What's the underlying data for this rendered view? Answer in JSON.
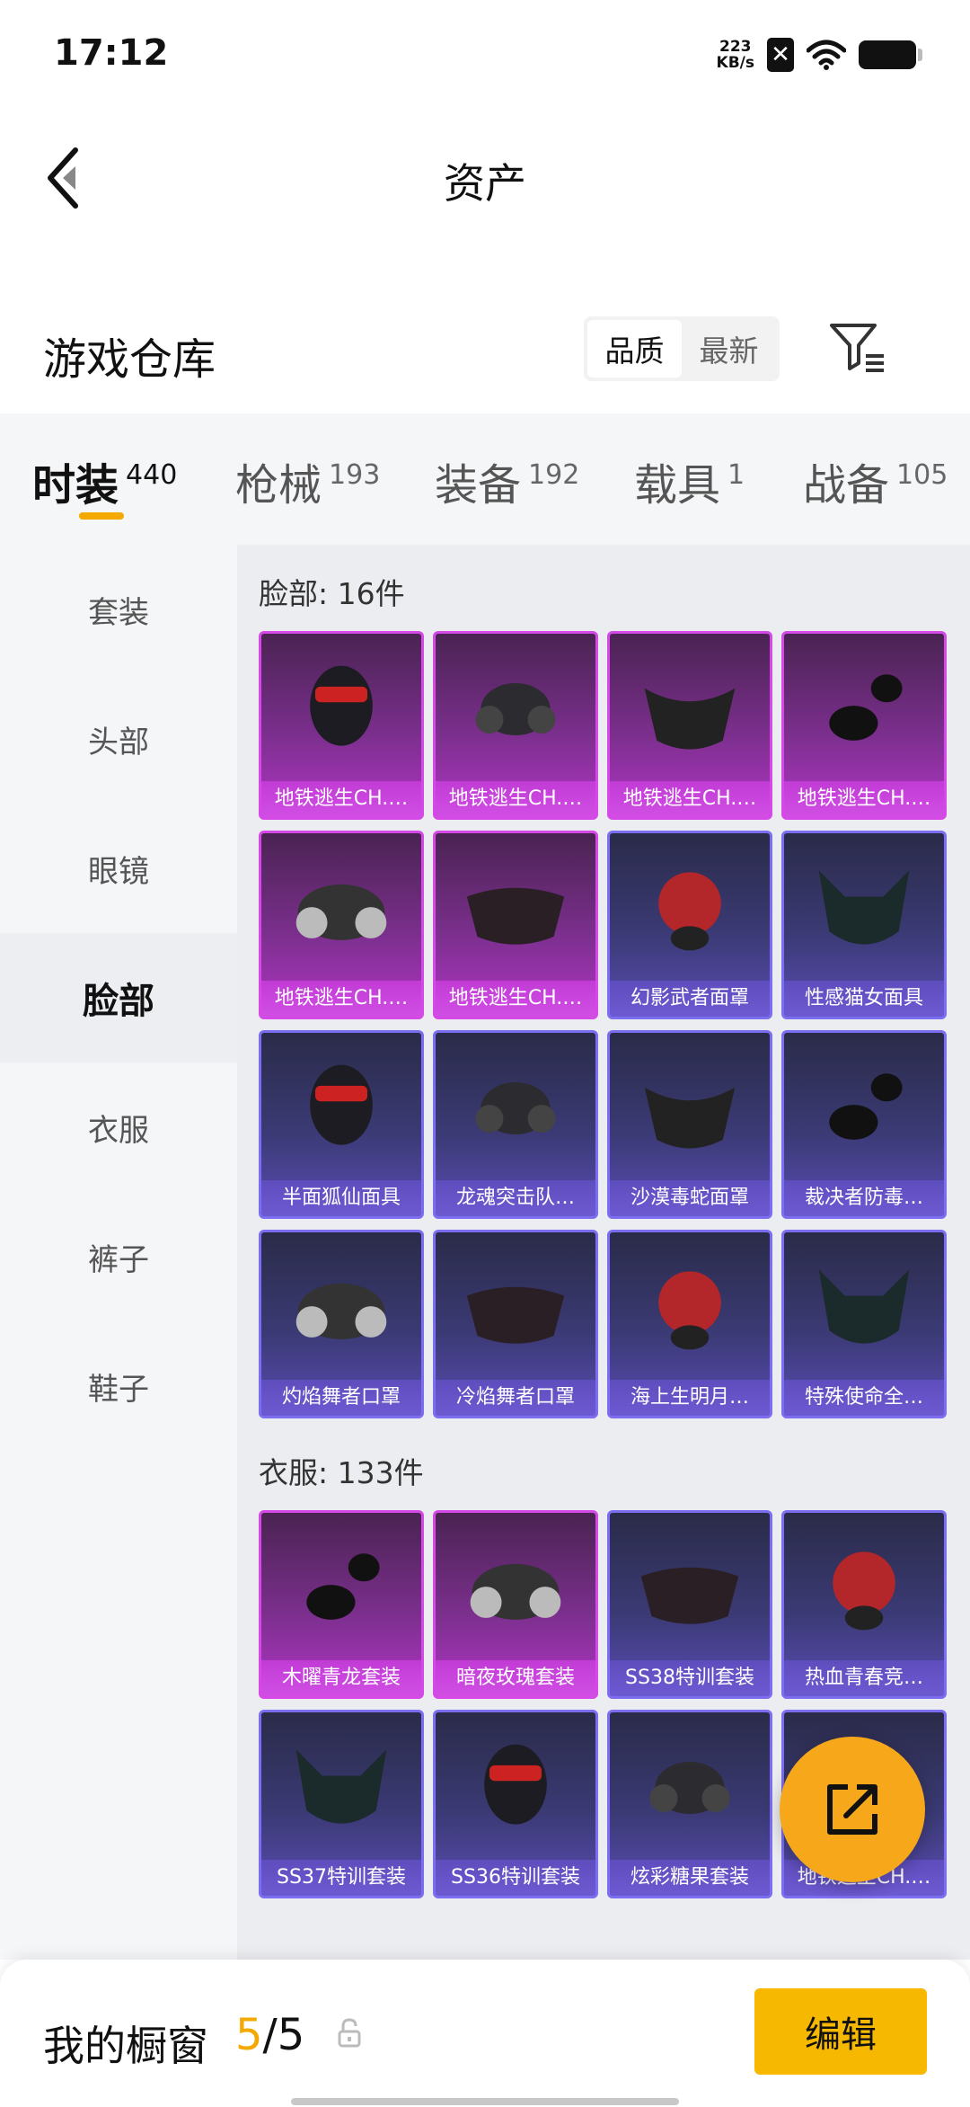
{
  "status_bar": {
    "time": "17:12",
    "net_speed_value": "223",
    "net_speed_unit": "KB/s"
  },
  "nav": {
    "title": "资产"
  },
  "warehouse": {
    "title": "游戏仓库",
    "sort_options": [
      "品质",
      "最新"
    ],
    "sort_selected": "品质"
  },
  "categories": [
    {
      "label": "时装",
      "count": "440",
      "active": true
    },
    {
      "label": "枪械",
      "count": "193"
    },
    {
      "label": "装备",
      "count": "192"
    },
    {
      "label": "载具",
      "count": "1"
    },
    {
      "label": "战备",
      "count": "105"
    }
  ],
  "sidebar": {
    "items": [
      "套装",
      "头部",
      "眼镜",
      "脸部",
      "衣服",
      "裤子",
      "鞋子"
    ],
    "selected": "脸部"
  },
  "sections": [
    {
      "title": "脸部: 16件",
      "items": [
        {
          "name": "地铁逃生CH.…",
          "rarity": "purple"
        },
        {
          "name": "地铁逃生CH.…",
          "rarity": "purple"
        },
        {
          "name": "地铁逃生CH.…",
          "rarity": "purple"
        },
        {
          "name": "地铁逃生CH.…",
          "rarity": "purple"
        },
        {
          "name": "地铁逃生CH.…",
          "rarity": "purple"
        },
        {
          "name": "地铁逃生CH.…",
          "rarity": "purple"
        },
        {
          "name": "幻影武者面罩",
          "rarity": "blue"
        },
        {
          "name": "性感猫女面具",
          "rarity": "blue"
        },
        {
          "name": "半面狐仙面具",
          "rarity": "blue"
        },
        {
          "name": "龙魂突击队…",
          "rarity": "blue"
        },
        {
          "name": "沙漠毒蛇面罩",
          "rarity": "blue"
        },
        {
          "name": "裁决者防毒…",
          "rarity": "blue"
        },
        {
          "name": "灼焰舞者口罩",
          "rarity": "blue"
        },
        {
          "name": "冷焰舞者口罩",
          "rarity": "blue"
        },
        {
          "name": "海上生明月…",
          "rarity": "blue"
        },
        {
          "name": "特殊使命全…",
          "rarity": "blue"
        }
      ]
    },
    {
      "title": "衣服: 133件",
      "items": [
        {
          "name": "木曜青龙套装",
          "rarity": "purple"
        },
        {
          "name": "暗夜玫瑰套装",
          "rarity": "purple"
        },
        {
          "name": "SS38特训套装",
          "rarity": "blue"
        },
        {
          "name": "热血青春竞…",
          "rarity": "blue"
        },
        {
          "name": "SS37特训套装",
          "rarity": "blue"
        },
        {
          "name": "SS36特训套装",
          "rarity": "blue"
        },
        {
          "name": "炫彩糖果套装",
          "rarity": "blue"
        },
        {
          "name": "地铁逃生CH.…",
          "rarity": "blue"
        }
      ]
    }
  ],
  "bottom": {
    "window_label": "我的橱窗",
    "window_current": "5",
    "window_total": "/5",
    "edit_label": "编辑"
  },
  "colors": {
    "accent": "#f4a900",
    "epic_purple": "#d549e6",
    "rare_blue": "#7c6ef0"
  }
}
